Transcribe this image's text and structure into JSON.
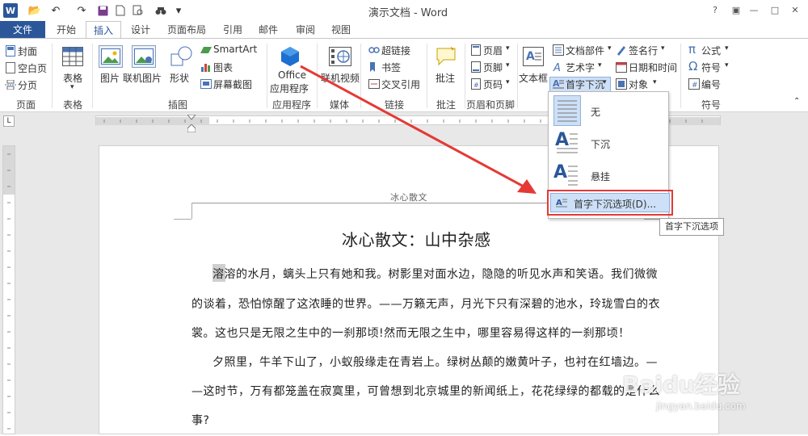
{
  "title_bar": {
    "doc_title": "演示文档 - Word",
    "app_icon": "W"
  },
  "tabs": [
    {
      "label": "文件"
    },
    {
      "label": "开始"
    },
    {
      "label": "插入"
    },
    {
      "label": "设计"
    },
    {
      "label": "页面布局"
    },
    {
      "label": "引用"
    },
    {
      "label": "邮件"
    },
    {
      "label": "审阅"
    },
    {
      "label": "视图"
    }
  ],
  "ribbon": {
    "pages": {
      "cover": "封面",
      "blank": "空白页",
      "break": "分页",
      "group": "页面"
    },
    "tables": {
      "table": "表格",
      "group": "表格"
    },
    "illustrations": {
      "picture": "图片",
      "online_picture": "联机图片",
      "shapes": "形状",
      "smartart": "SmartArt",
      "chart": "图表",
      "screenshot": "屏幕截图",
      "group": "插图"
    },
    "apps": {
      "office_line1": "Office",
      "office_line2": "应用程序",
      "group": "应用程序"
    },
    "media": {
      "online_video": "联机视频",
      "group": "媒体"
    },
    "links": {
      "hyperlink": "超链接",
      "bookmark": "书签",
      "crossref": "交叉引用",
      "group": "链接"
    },
    "comments": {
      "comment": "批注",
      "group": "批注"
    },
    "header_footer": {
      "header": "页眉",
      "footer": "页脚",
      "page_number": "页码",
      "group": "页眉和页脚"
    },
    "text": {
      "textbox": "文本框",
      "quick_parts": "文档部件",
      "wordart": "艺术字",
      "dropcap": "首字下沉",
      "signature": "签名行",
      "datetime": "日期和时间",
      "object": "对象"
    },
    "symbols": {
      "equation": "公式",
      "symbol": "符号",
      "numbering": "编号",
      "group": "符号"
    }
  },
  "dropdown": {
    "items": [
      {
        "label": "无"
      },
      {
        "label": "下沉"
      },
      {
        "label": "悬挂"
      }
    ],
    "options": "首字下沉选项(D)..."
  },
  "tooltip": "首字下沉选项",
  "document": {
    "header": "冰心散文",
    "title": "冰心散文：山中杂感",
    "lines": [
      "溶溶的水月，螭头上只有她和我。树影里对面水边，隐隐的听见水声和笑语。我们微微",
      "的谈着，恐怕惊醒了这浓睡的世界。——万籁无声，月光下只有深碧的池水，玲珑雪白的衣",
      "裳。这也只是无限之生中的一刹那顷!然而无限之生中，哪里容易得这样的一刹那顷！",
      "夕照里，牛羊下山了，小蚁般缘走在青岩上。绿树丛颠的嫩黄叶子，也衬在红墙边。—",
      "—这时节，万有都笼盖在寂寞里，可曾想到北京城里的新闻纸上，花花绿绿的都载的是什么",
      "事?"
    ]
  },
  "watermark": {
    "brand": "Baidu经验",
    "url": "jingyan.baidu.com"
  },
  "colors": {
    "accent": "#2b579a",
    "arrow": "#e53935"
  }
}
